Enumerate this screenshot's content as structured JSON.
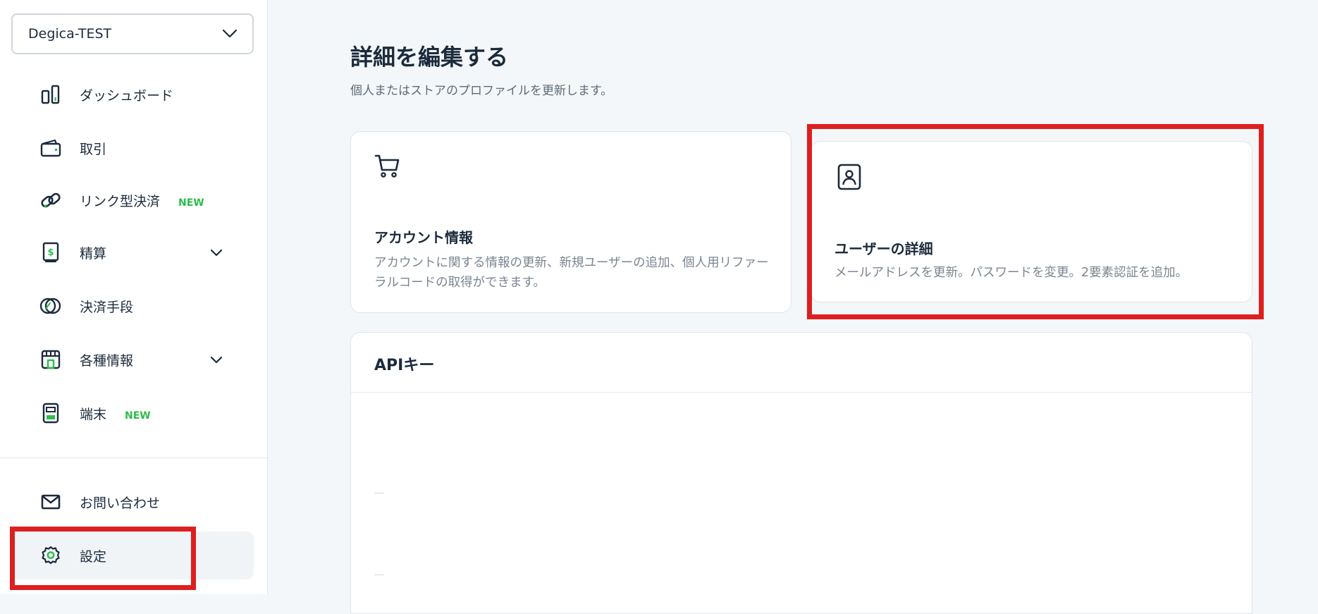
{
  "sidebar": {
    "account_selector": {
      "value": "Degica-TEST"
    },
    "items": [
      {
        "label": "ダッシュボード",
        "icon": "dashboard-icon"
      },
      {
        "label": "取引",
        "icon": "wallet-icon"
      },
      {
        "label": "リンク型決済",
        "icon": "link-icon",
        "badge": "NEW"
      },
      {
        "label": "精算",
        "icon": "payout-icon",
        "expandable": true
      },
      {
        "label": "決済手段",
        "icon": "payment-method-icon"
      },
      {
        "label": "各種情報",
        "icon": "store-icon",
        "expandable": true
      },
      {
        "label": "端末",
        "icon": "terminal-icon",
        "badge": "NEW"
      }
    ],
    "bottom_items": [
      {
        "label": "お問い合わせ",
        "icon": "mail-icon"
      },
      {
        "label": "設定",
        "icon": "gear-icon",
        "active": true
      }
    ]
  },
  "main": {
    "title": "詳細を編集する",
    "subtitle": "個人またはストアのプロファイルを更新します。",
    "cards": [
      {
        "icon": "cart-icon",
        "title": "アカウント情報",
        "description": "アカウントに関する情報の更新、新規ユーザーの追加、個人用リファーラルコードの取得ができます。"
      },
      {
        "icon": "user-badge-icon",
        "title": "ユーザーの詳細",
        "description": "メールアドレスを更新。パスワードを変更。2要素認証を追加。"
      }
    ],
    "api_section": {
      "title": "APIキー"
    }
  },
  "colors": {
    "accent_green": "#2dbd4c",
    "highlight_red": "#dd1f1f",
    "text_dark": "#1b2b3c",
    "text_muted": "#7a8591",
    "background": "#f4f7f9"
  }
}
